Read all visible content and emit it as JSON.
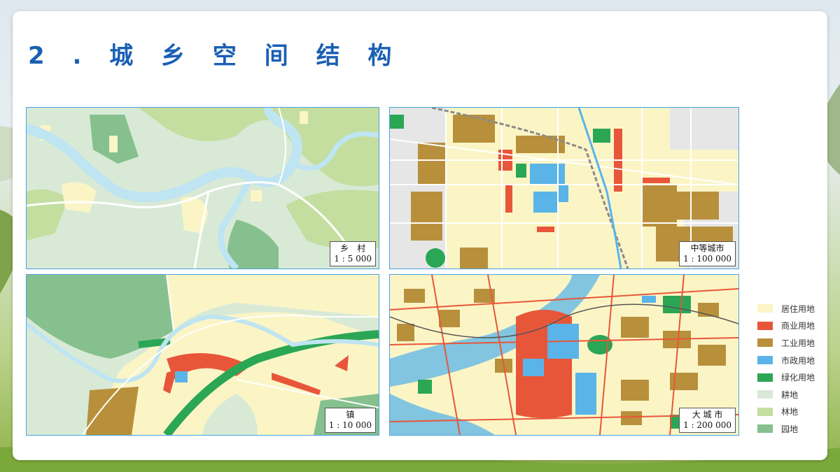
{
  "slide": {
    "title": "2 . 城 乡 空 间 结 构"
  },
  "maps": [
    {
      "name": "乡　村",
      "scale": "1 : 5 000"
    },
    {
      "name": "中等城市",
      "scale": "1 : 100 000"
    },
    {
      "name": "镇",
      "scale": "1 : 10 000"
    },
    {
      "name": "大 城 市",
      "scale": "1 : 200 000"
    }
  ],
  "legend": [
    {
      "label": "居住用地",
      "color": "#fbf5c6"
    },
    {
      "label": "商业用地",
      "color": "#e8563a"
    },
    {
      "label": "工业用地",
      "color": "#b8903c"
    },
    {
      "label": "市政用地",
      "color": "#5ab4e8"
    },
    {
      "label": "绿化用地",
      "color": "#2aa655"
    },
    {
      "label": "耕地",
      "color": "#d8ead6"
    },
    {
      "label": "林地",
      "color": "#c4dea0"
    },
    {
      "label": "园地",
      "color": "#86c08e"
    }
  ]
}
